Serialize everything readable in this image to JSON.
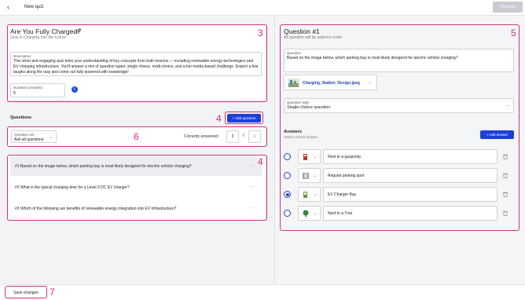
{
  "topbar": {
    "back_glyph": "‹",
    "title": "New quiz",
    "preview_label": "Preview"
  },
  "quiz": {
    "title": "Are You Fully Charged?",
    "subtitle": "Quiz in Charging Into the Future",
    "description_label": "Description",
    "description": "This short and engaging quiz tests your understanding of key concepts from both lessons — including renewable energy technologies and EV charging infrastructure. You'll answer a mix of question types: single choice, multi-choice, and a fun media-based challenge. Expect a few taughs along the way and come out fully powered with knowledge!",
    "duration_label": "Duration (minutes)",
    "duration": "5",
    "info_glyph": "i"
  },
  "questions_section": {
    "heading": "Questions",
    "add_label": "+ Add question",
    "question_set_label": "Question set",
    "question_set_value": "Ask all questions",
    "correctly_answered_label": "Correctly answered:",
    "correct_value": "2",
    "slash": "/",
    "total_value": "3",
    "items": [
      {
        "text": "#1 Based on the image below, which parking bay is most likely designed for electric vehicle charging?",
        "more": "···"
      },
      {
        "text": "#2 What is the typical charging time for a Level 3 DC EV charger?",
        "more": "···"
      },
      {
        "text": "#3 Which of the following are benefits of renewable energy integration into EV infrastructure?",
        "more": "···"
      }
    ]
  },
  "footer": {
    "save_label": "Save changes"
  },
  "annotations": {
    "n3": "3",
    "n4a": "4",
    "n4b": "4",
    "n5": "5",
    "n6": "6",
    "n7": "7"
  },
  "editor": {
    "title": "Question #1",
    "subtitle": "All question will be asked in order",
    "question_label": "Question",
    "question_text": "Based on the image below, which parking bay is most likely designed for electric vehicle charging?",
    "file_name": "Charging_Station_Design.jpeg",
    "style_label": "Question style",
    "style_value": "Single-choice question",
    "answers_heading": "Answers",
    "answers_sub": "Select correct answer",
    "add_answer_label": "+ Add answer",
    "answers": [
      {
        "text": "Next to a gaspump",
        "icon": "gas-pump-icon",
        "selected": false
      },
      {
        "text": "Regular parking spot",
        "icon": "parking-icon",
        "selected": false
      },
      {
        "text": "EV Charger Bay",
        "icon": "ev-charger-icon",
        "selected": true
      },
      {
        "text": "Next to a Tree",
        "icon": "tree-icon",
        "selected": false
      }
    ]
  },
  "colors": {
    "accent": "#1d3fd8",
    "highlight": "#d6307e"
  }
}
